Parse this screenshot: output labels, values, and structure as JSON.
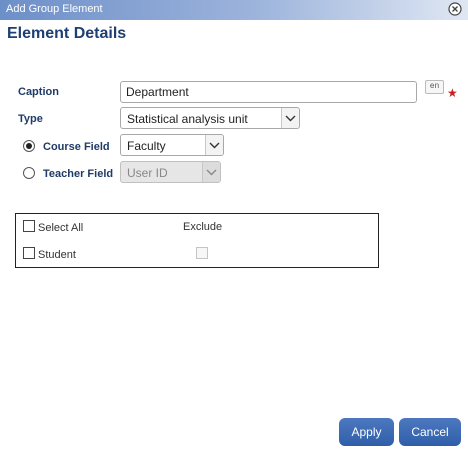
{
  "window": {
    "title": "Add Group Element"
  },
  "page": {
    "heading": "Element Details"
  },
  "form": {
    "caption_label": "Caption",
    "caption_value": "Department",
    "lang_code": "en",
    "required_mark": "★",
    "type_label": "Type",
    "type_value": "Statistical analysis unit",
    "course_field_label": "Course Field",
    "course_field_value": "Faculty",
    "teacher_field_label": "Teacher Field",
    "teacher_field_value": "User ID"
  },
  "table": {
    "select_all_label": "Select All",
    "exclude_header": "Exclude",
    "rows": [
      {
        "label": "Student"
      }
    ]
  },
  "buttons": {
    "apply": "Apply",
    "cancel": "Cancel"
  }
}
